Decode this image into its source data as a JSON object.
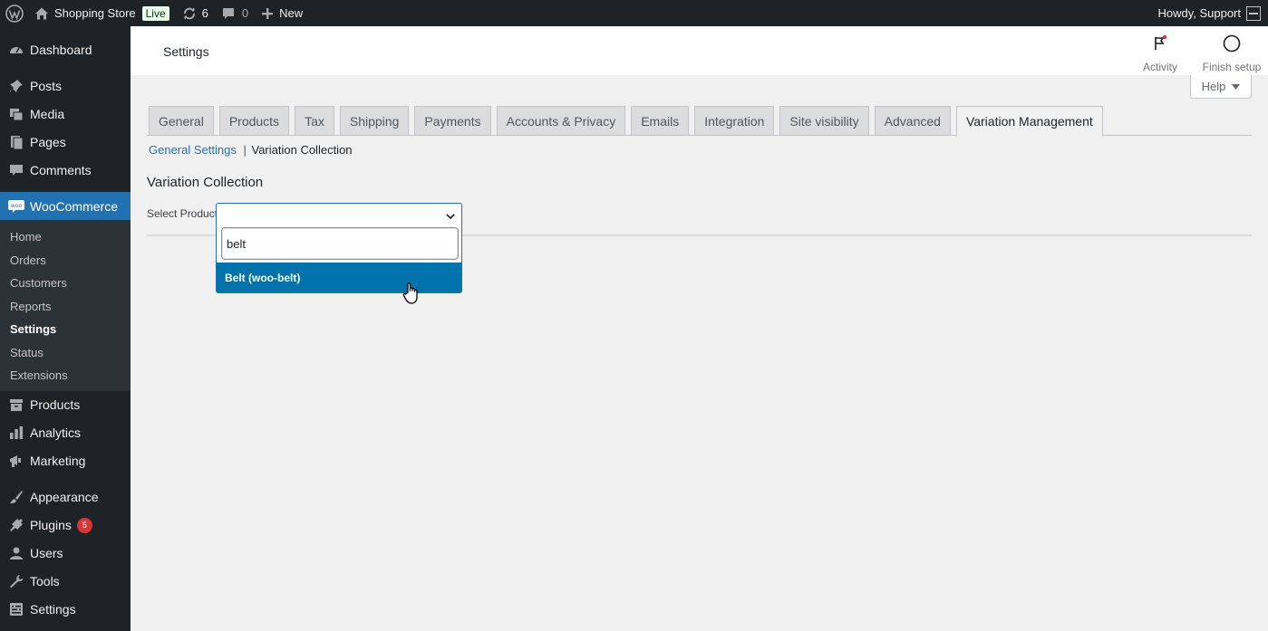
{
  "adminbar": {
    "site_name": "Shopping Store",
    "live_badge": "Live",
    "updates_count": "6",
    "comments_count": "0",
    "new_label": "New",
    "greeting": "Howdy, Support"
  },
  "sidebar": {
    "top_items": [
      {
        "label": "Dashboard",
        "icon": "dashboard-icon"
      }
    ],
    "content_items": [
      {
        "label": "Posts",
        "icon": "pin-icon"
      },
      {
        "label": "Media",
        "icon": "media-icon"
      },
      {
        "label": "Pages",
        "icon": "pages-icon"
      },
      {
        "label": "Comments",
        "icon": "comment-icon"
      }
    ],
    "woocommerce": {
      "label": "WooCommerce",
      "icon": "woo-icon"
    },
    "woo_submenu": [
      "Home",
      "Orders",
      "Customers",
      "Reports",
      "Settings",
      "Status",
      "Extensions"
    ],
    "woo_submenu_current": "Settings",
    "lower_items": [
      {
        "label": "Products",
        "icon": "archive-icon"
      },
      {
        "label": "Analytics",
        "icon": "bar-chart-icon"
      },
      {
        "label": "Marketing",
        "icon": "megaphone-icon"
      }
    ],
    "admin_items": [
      {
        "label": "Appearance",
        "icon": "brush-icon"
      },
      {
        "label": "Plugins",
        "icon": "plug-icon",
        "badge": "5"
      },
      {
        "label": "Users",
        "icon": "user-icon"
      },
      {
        "label": "Tools",
        "icon": "wrench-icon"
      },
      {
        "label": "Settings",
        "icon": "settings-icon"
      }
    ]
  },
  "header": {
    "title": "Settings",
    "activity_label": "Activity",
    "finish_setup_label": "Finish setup",
    "help_label": "Help"
  },
  "tabs": [
    {
      "label": "General",
      "active": false
    },
    {
      "label": "Products",
      "active": false
    },
    {
      "label": "Tax",
      "active": false
    },
    {
      "label": "Shipping",
      "active": false
    },
    {
      "label": "Payments",
      "active": false
    },
    {
      "label": "Accounts & Privacy",
      "active": false
    },
    {
      "label": "Emails",
      "active": false
    },
    {
      "label": "Integration",
      "active": false
    },
    {
      "label": "Site visibility",
      "active": false
    },
    {
      "label": "Advanced",
      "active": false
    },
    {
      "label": "Variation Management",
      "active": true
    }
  ],
  "subnav": {
    "general_settings": "General Settings",
    "separator": "|",
    "current": "Variation Collection"
  },
  "section": {
    "title": "Variation Collection",
    "select_label": "Select Product"
  },
  "dropdown": {
    "search_value": "belt",
    "options": [
      "Belt (woo-belt)"
    ]
  },
  "colors": {
    "admin_dark": "#1d2327",
    "accent": "#2271b1",
    "highlight": "#0073aa",
    "badge": "#d63638"
  }
}
